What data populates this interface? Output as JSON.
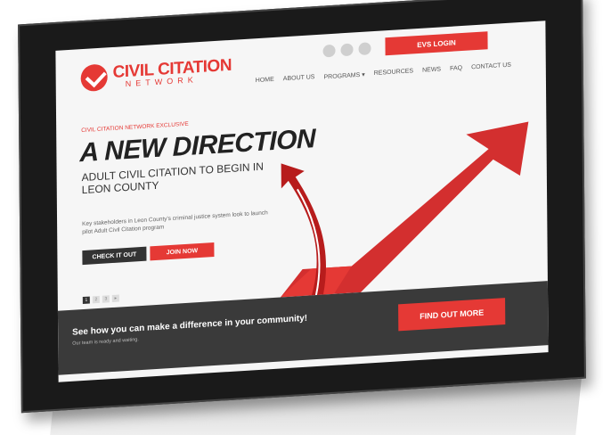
{
  "header": {
    "logo_title": "CIVIL CITATION",
    "logo_subtitle": "NETWORK",
    "evs_login": "EVS LOGIN",
    "social_icons": [
      "social-icon-1",
      "social-icon-2",
      "social-icon-3"
    ]
  },
  "nav": {
    "items": [
      "HOME",
      "ABOUT US",
      "PROGRAMS ▾",
      "RESOURCES",
      "NEWS",
      "FAQ",
      "CONTACT US"
    ]
  },
  "hero": {
    "eyebrow": "CIVIL CITATION NETWORK EXCLUSIVE",
    "headline": "A NEW DIRECTION",
    "subhead": "ADULT CIVIL CITATION TO BEGIN IN LEON COUNTY",
    "description": "Key stakeholders in Leon County's criminal justice system look to launch pilot Adult Civil Citation program",
    "check_button": "CHECK IT OUT",
    "join_button": "JOIN NOW",
    "pager": [
      "1",
      "2",
      "3",
      "▸"
    ]
  },
  "cta": {
    "title": "See how you can make a difference in your community!",
    "subtitle": "Our team is ready and waiting.",
    "button": "FIND OUT MORE"
  },
  "colors": {
    "accent": "#e53935",
    "dark": "#3a3a3a",
    "frame": "#1a1a1a"
  }
}
